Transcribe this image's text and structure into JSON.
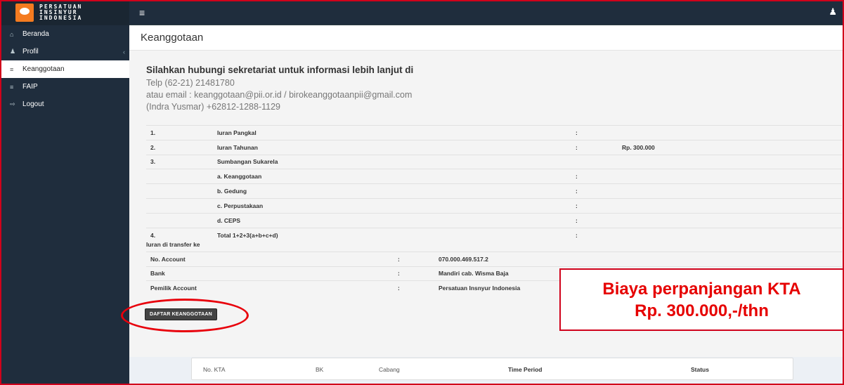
{
  "brand": {
    "logo_lines": [
      "PERSATUAN",
      "INSINYUR",
      "INDONESIA"
    ],
    "logo_badge": "PII",
    "accent": "#f47b20"
  },
  "topbar": {
    "menu_icon": "hamburger-icon",
    "user_icon": "user-icon"
  },
  "sidebar": {
    "items": [
      {
        "label": "Beranda",
        "icon": "home-icon"
      },
      {
        "label": "Profil",
        "icon": "user-icon"
      },
      {
        "label": "Keanggotaan",
        "icon": "list-icon",
        "active": true
      },
      {
        "label": "FAIP",
        "icon": "list-icon"
      },
      {
        "label": "Logout",
        "icon": "logout-icon"
      }
    ]
  },
  "page": {
    "title": "Keanggotaan"
  },
  "contact": {
    "title": "Silahkan hubungi sekretariat untuk informasi lebih lanjut di",
    "phone": "Telp (62-21) 21481780",
    "email": "atau email : keanggotaan@pii.or.id / birokeanggotaanpii@gmail.com",
    "person": "(Indra Yusmar) +62812-1288-1129"
  },
  "fees": [
    {
      "no": "1.",
      "label": "Iuran Pangkal",
      "sep": ":",
      "value": ""
    },
    {
      "no": "2.",
      "label": "Iuran Tahunan",
      "sep": ":",
      "value": "Rp. 300.000"
    },
    {
      "no": "3.",
      "label": "Sumbangan Sukarela",
      "sep": "",
      "value": ""
    },
    {
      "no": "",
      "label": "a. Keanggotaan",
      "sep": ":",
      "value": ""
    },
    {
      "no": "",
      "label": "b. Gedung",
      "sep": ":",
      "value": ""
    },
    {
      "no": "",
      "label": "c. Perpustakaan",
      "sep": ":",
      "value": ""
    },
    {
      "no": "",
      "label": "d. CEPS",
      "sep": ":",
      "value": ""
    },
    {
      "no": "4.",
      "label": "Total 1+2+3(a+b+c+d)",
      "sep": ":",
      "value": ""
    }
  ],
  "transfer": {
    "title": "Iuran di transfer ke",
    "rows": [
      {
        "label": "No. Account",
        "sep": ":",
        "value": "070.000.469.517.2"
      },
      {
        "label": "Bank",
        "sep": ":",
        "value": "Mandiri cab. Wisma Baja"
      },
      {
        "label": "Pemilik Account",
        "sep": ":",
        "value": "Persatuan Insnyur Indonesia"
      }
    ]
  },
  "actions": {
    "daftar_label": "DAFTAR KEANGGOTAAN"
  },
  "callout": {
    "line1": "Biaya perpanjangan KTA",
    "line2": "Rp. 300.000,-/thn"
  },
  "kta_table": {
    "headers": [
      "No. KTA",
      "BK",
      "Cabang",
      "Time Period",
      "Status"
    ]
  }
}
